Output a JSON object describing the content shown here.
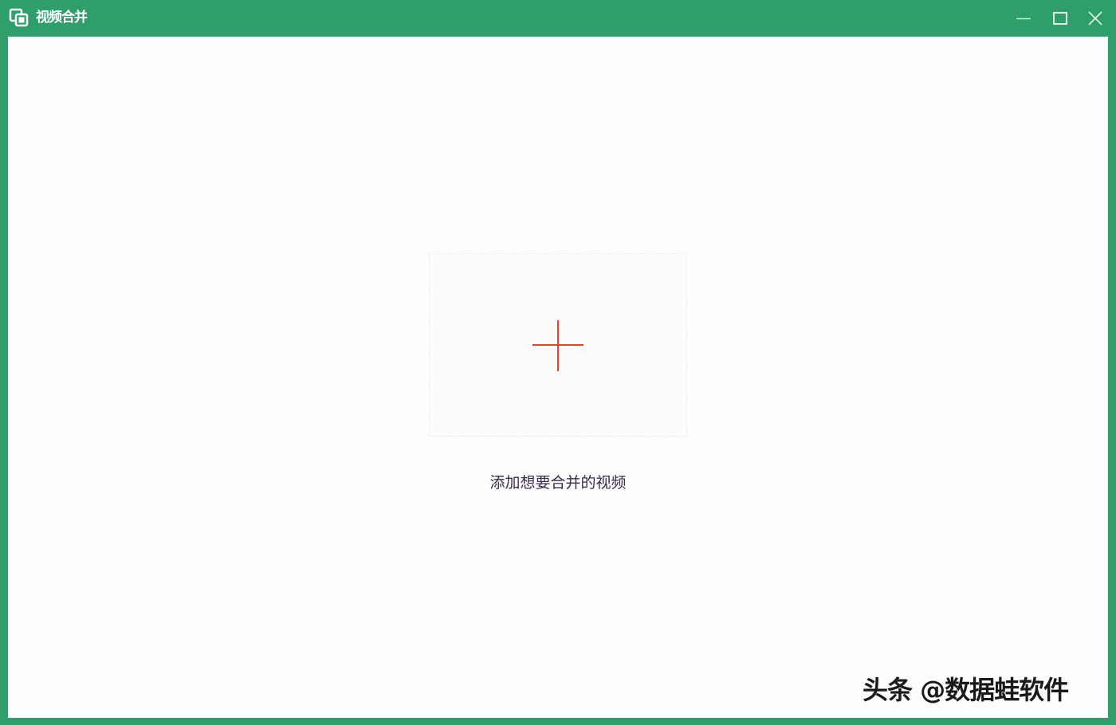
{
  "window": {
    "title": "视频合并",
    "brand_color": "#2e9e6b",
    "controls": {
      "minimize": "minimize-icon",
      "maximize": "maximize-icon",
      "close": "close-icon"
    }
  },
  "main": {
    "add_icon": "plus-icon",
    "add_color": "#e0442a",
    "add_label": "添加想要合并的视频"
  },
  "watermark": {
    "text": "头条 @数据蛙软件"
  }
}
